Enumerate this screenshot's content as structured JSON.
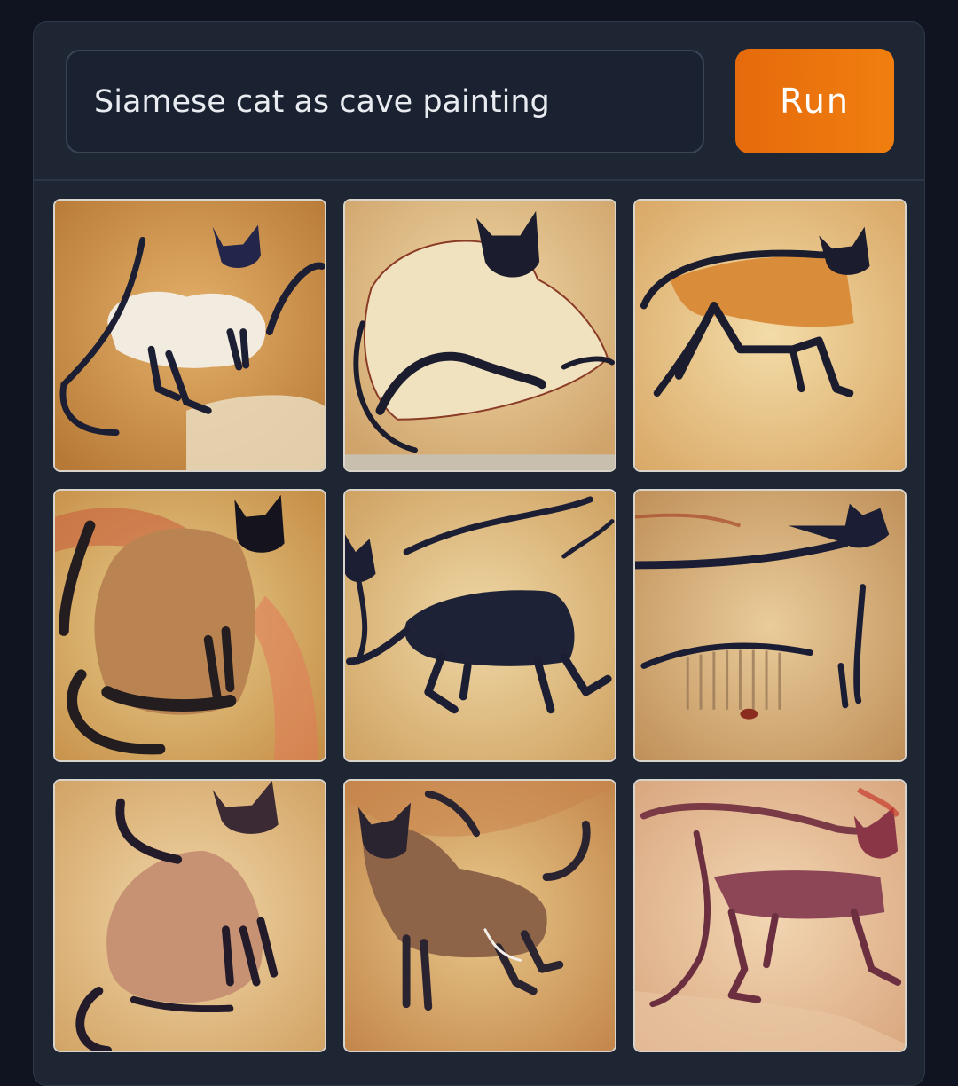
{
  "prompt": {
    "value": "Siamese cat as cave painting"
  },
  "run_button": {
    "label": "Run"
  },
  "colors": {
    "page_background": "#0f1420",
    "panel_background": "#1e2634",
    "accent": "#f17f0f"
  },
  "results": {
    "count": 9,
    "tiles": [
      {
        "subject": "siamese cat standing, light body, dark points"
      },
      {
        "subject": "siamese cat sitting, outlined, dark face"
      },
      {
        "subject": "orange cat walking, dark outline"
      },
      {
        "subject": "siamese cat sitting, back view"
      },
      {
        "subject": "dark cat walking, silhouette"
      },
      {
        "subject": "long cat outline with ribbed body"
      },
      {
        "subject": "siamese cat sitting, profile"
      },
      {
        "subject": "brown cat walking, textured body"
      },
      {
        "subject": "reddish cat figure, faded outline"
      }
    ]
  }
}
